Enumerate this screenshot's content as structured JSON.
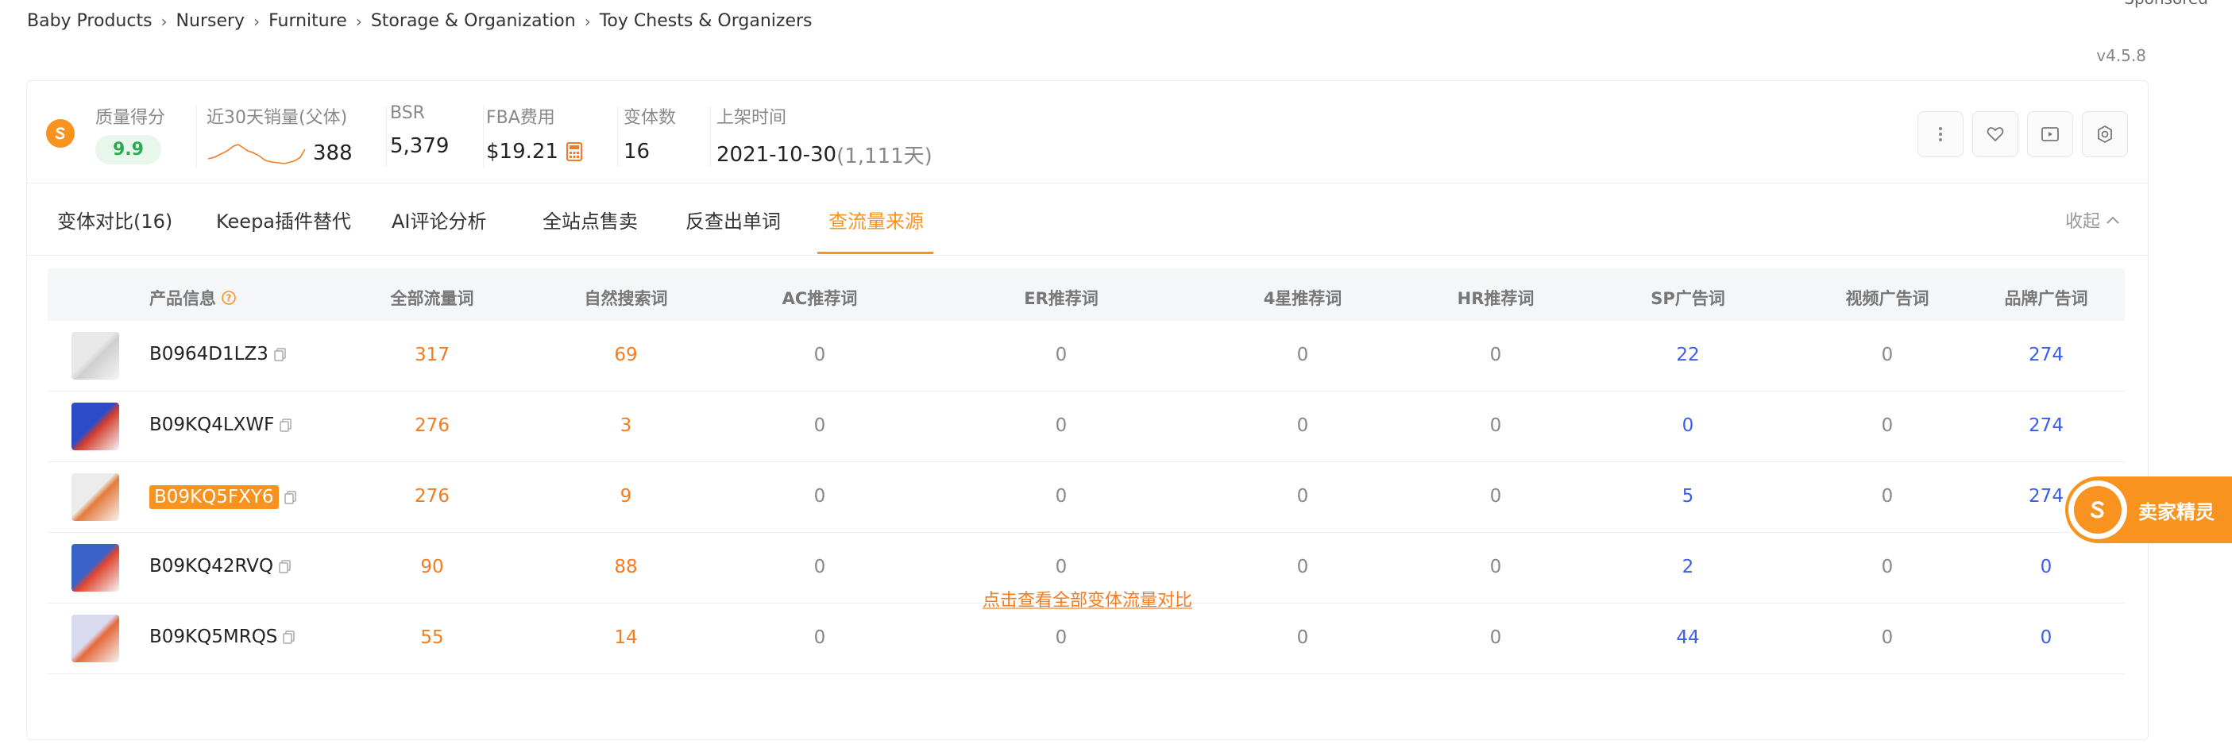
{
  "breadcrumb": [
    "Baby Products",
    "Nursery",
    "Furniture",
    "Storage & Organization",
    "Toy Chests & Organizers"
  ],
  "breadcrumb_separator": "›",
  "sponsored": "Sponsored",
  "version": "v4.5.8",
  "metrics": {
    "quality_label": "质量得分",
    "quality_value": "9.9",
    "sales_label": "近30天销量(父体)",
    "sales_value": "388",
    "bsr_label": "BSR",
    "bsr_value": "5,379",
    "fba_label": "FBA费用",
    "fba_value": "$19.21",
    "variants_label": "变体数",
    "variants_value": "16",
    "listed_label": "上架时间",
    "listed_date": "2021-10-30",
    "listed_days": "(1,111天)"
  },
  "tabs": [
    "变体对比(16)",
    "Keepa插件替代",
    "AI评论分析",
    "全站点售卖",
    "反查出单词",
    "查流量来源"
  ],
  "active_tab_index": 5,
  "collapse_label": "收起",
  "table": {
    "headers": [
      "产品信息",
      "全部流量词",
      "自然搜索词",
      "AC推荐词",
      "ER推荐词",
      "4星推荐词",
      "HR推荐词",
      "SP广告词",
      "视频广告词",
      "品牌广告词"
    ],
    "rows": [
      {
        "asin": "B0964D1LZ3",
        "values": [
          "317",
          "69",
          "0",
          "0",
          "0",
          "0",
          "22",
          "0",
          "274"
        ]
      },
      {
        "asin": "B09KQ4LXWF",
        "values": [
          "276",
          "3",
          "0",
          "0",
          "0",
          "0",
          "0",
          "0",
          "274"
        ]
      },
      {
        "asin": "B09KQ5FXY6",
        "values": [
          "276",
          "9",
          "0",
          "0",
          "0",
          "0",
          "5",
          "0",
          "274"
        ],
        "highlighted": true
      },
      {
        "asin": "B09KQ42RVQ",
        "values": [
          "90",
          "88",
          "0",
          "0",
          "0",
          "0",
          "2",
          "0",
          "0"
        ]
      },
      {
        "asin": "B09KQ5MRQS",
        "values": [
          "55",
          "14",
          "0",
          "0",
          "0",
          "0",
          "44",
          "0",
          "0"
        ]
      }
    ]
  },
  "footer_link": "点击查看全部变体流量对比",
  "float_widget_label": "卖家精灵",
  "colors": {
    "accent": "#f7931e",
    "link_blue": "#3b5de7",
    "score_green": "#2eaa52"
  },
  "icons": [
    "sellersprite-logo-icon",
    "calculator-icon",
    "more-vertical-icon",
    "heart-icon",
    "video-play-icon",
    "settings-gear-icon",
    "help-circle-icon",
    "copy-icon",
    "chevron-up-icon"
  ]
}
